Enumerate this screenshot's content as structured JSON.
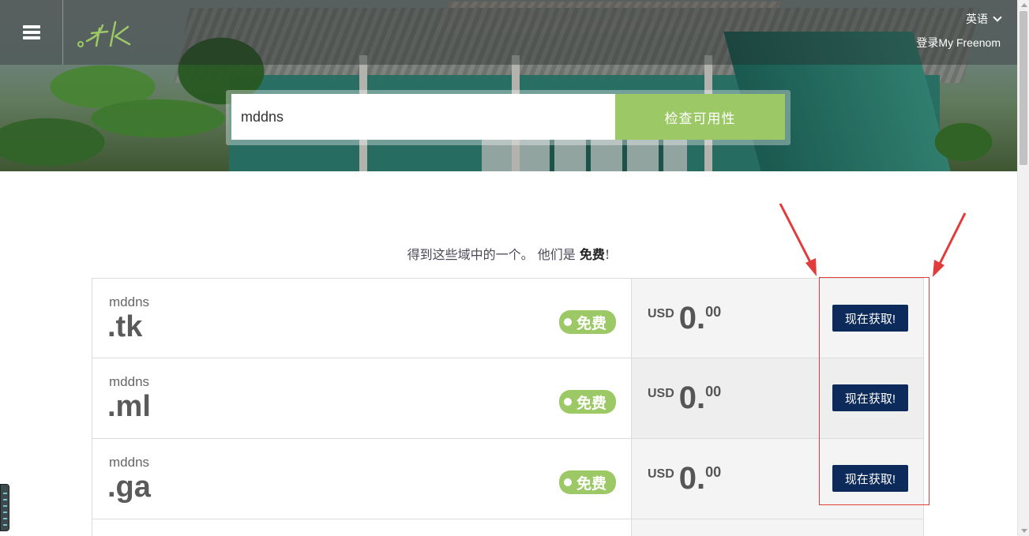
{
  "header": {
    "menu_icon": "hamburger-icon",
    "logo_text": ".tk",
    "language_label": "英语",
    "login_label": "登录My Freenom"
  },
  "search": {
    "value": "mddns",
    "button_label": "检查可用性"
  },
  "tagline": {
    "text": "得到这些域中的一个。 他们是 ",
    "emphasis": "免费",
    "suffix": "!"
  },
  "domains": [
    {
      "name": "mddns",
      "tld": ".tk",
      "badge": "免费",
      "currency": "USD",
      "price_int": "0.",
      "price_dec": "00",
      "button_label": "现在获取!"
    },
    {
      "name": "mddns",
      "tld": ".ml",
      "badge": "免费",
      "currency": "USD",
      "price_int": "0.",
      "price_dec": "00",
      "button_label": "现在获取!"
    },
    {
      "name": "mddns",
      "tld": ".ga",
      "badge": "免费",
      "currency": "USD",
      "price_int": "0.",
      "price_dec": "00",
      "button_label": "现在获取!"
    }
  ],
  "colors": {
    "accent_green": "#9cc866",
    "button_navy": "#0d2b5a",
    "annotation_red": "#e23b3b"
  }
}
